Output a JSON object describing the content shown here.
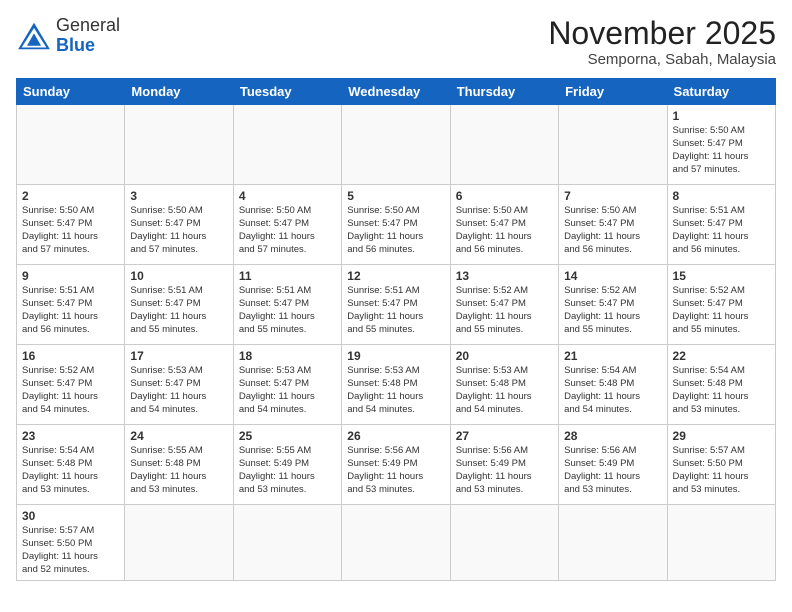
{
  "header": {
    "logo_general": "General",
    "logo_blue": "Blue",
    "month_title": "November 2025",
    "location": "Semporna, Sabah, Malaysia"
  },
  "weekdays": [
    "Sunday",
    "Monday",
    "Tuesday",
    "Wednesday",
    "Thursday",
    "Friday",
    "Saturday"
  ],
  "weeks": [
    [
      {
        "day": "",
        "info": ""
      },
      {
        "day": "",
        "info": ""
      },
      {
        "day": "",
        "info": ""
      },
      {
        "day": "",
        "info": ""
      },
      {
        "day": "",
        "info": ""
      },
      {
        "day": "",
        "info": ""
      },
      {
        "day": "1",
        "info": "Sunrise: 5:50 AM\nSunset: 5:47 PM\nDaylight: 11 hours\nand 57 minutes."
      }
    ],
    [
      {
        "day": "2",
        "info": "Sunrise: 5:50 AM\nSunset: 5:47 PM\nDaylight: 11 hours\nand 57 minutes."
      },
      {
        "day": "3",
        "info": "Sunrise: 5:50 AM\nSunset: 5:47 PM\nDaylight: 11 hours\nand 57 minutes."
      },
      {
        "day": "4",
        "info": "Sunrise: 5:50 AM\nSunset: 5:47 PM\nDaylight: 11 hours\nand 57 minutes."
      },
      {
        "day": "5",
        "info": "Sunrise: 5:50 AM\nSunset: 5:47 PM\nDaylight: 11 hours\nand 56 minutes."
      },
      {
        "day": "6",
        "info": "Sunrise: 5:50 AM\nSunset: 5:47 PM\nDaylight: 11 hours\nand 56 minutes."
      },
      {
        "day": "7",
        "info": "Sunrise: 5:50 AM\nSunset: 5:47 PM\nDaylight: 11 hours\nand 56 minutes."
      },
      {
        "day": "8",
        "info": "Sunrise: 5:51 AM\nSunset: 5:47 PM\nDaylight: 11 hours\nand 56 minutes."
      }
    ],
    [
      {
        "day": "9",
        "info": "Sunrise: 5:51 AM\nSunset: 5:47 PM\nDaylight: 11 hours\nand 56 minutes."
      },
      {
        "day": "10",
        "info": "Sunrise: 5:51 AM\nSunset: 5:47 PM\nDaylight: 11 hours\nand 55 minutes."
      },
      {
        "day": "11",
        "info": "Sunrise: 5:51 AM\nSunset: 5:47 PM\nDaylight: 11 hours\nand 55 minutes."
      },
      {
        "day": "12",
        "info": "Sunrise: 5:51 AM\nSunset: 5:47 PM\nDaylight: 11 hours\nand 55 minutes."
      },
      {
        "day": "13",
        "info": "Sunrise: 5:52 AM\nSunset: 5:47 PM\nDaylight: 11 hours\nand 55 minutes."
      },
      {
        "day": "14",
        "info": "Sunrise: 5:52 AM\nSunset: 5:47 PM\nDaylight: 11 hours\nand 55 minutes."
      },
      {
        "day": "15",
        "info": "Sunrise: 5:52 AM\nSunset: 5:47 PM\nDaylight: 11 hours\nand 55 minutes."
      }
    ],
    [
      {
        "day": "16",
        "info": "Sunrise: 5:52 AM\nSunset: 5:47 PM\nDaylight: 11 hours\nand 54 minutes."
      },
      {
        "day": "17",
        "info": "Sunrise: 5:53 AM\nSunset: 5:47 PM\nDaylight: 11 hours\nand 54 minutes."
      },
      {
        "day": "18",
        "info": "Sunrise: 5:53 AM\nSunset: 5:47 PM\nDaylight: 11 hours\nand 54 minutes."
      },
      {
        "day": "19",
        "info": "Sunrise: 5:53 AM\nSunset: 5:48 PM\nDaylight: 11 hours\nand 54 minutes."
      },
      {
        "day": "20",
        "info": "Sunrise: 5:53 AM\nSunset: 5:48 PM\nDaylight: 11 hours\nand 54 minutes."
      },
      {
        "day": "21",
        "info": "Sunrise: 5:54 AM\nSunset: 5:48 PM\nDaylight: 11 hours\nand 54 minutes."
      },
      {
        "day": "22",
        "info": "Sunrise: 5:54 AM\nSunset: 5:48 PM\nDaylight: 11 hours\nand 53 minutes."
      }
    ],
    [
      {
        "day": "23",
        "info": "Sunrise: 5:54 AM\nSunset: 5:48 PM\nDaylight: 11 hours\nand 53 minutes."
      },
      {
        "day": "24",
        "info": "Sunrise: 5:55 AM\nSunset: 5:48 PM\nDaylight: 11 hours\nand 53 minutes."
      },
      {
        "day": "25",
        "info": "Sunrise: 5:55 AM\nSunset: 5:49 PM\nDaylight: 11 hours\nand 53 minutes."
      },
      {
        "day": "26",
        "info": "Sunrise: 5:56 AM\nSunset: 5:49 PM\nDaylight: 11 hours\nand 53 minutes."
      },
      {
        "day": "27",
        "info": "Sunrise: 5:56 AM\nSunset: 5:49 PM\nDaylight: 11 hours\nand 53 minutes."
      },
      {
        "day": "28",
        "info": "Sunrise: 5:56 AM\nSunset: 5:49 PM\nDaylight: 11 hours\nand 53 minutes."
      },
      {
        "day": "29",
        "info": "Sunrise: 5:57 AM\nSunset: 5:50 PM\nDaylight: 11 hours\nand 53 minutes."
      }
    ],
    [
      {
        "day": "30",
        "info": "Sunrise: 5:57 AM\nSunset: 5:50 PM\nDaylight: 11 hours\nand 52 minutes."
      },
      {
        "day": "",
        "info": ""
      },
      {
        "day": "",
        "info": ""
      },
      {
        "day": "",
        "info": ""
      },
      {
        "day": "",
        "info": ""
      },
      {
        "day": "",
        "info": ""
      },
      {
        "day": "",
        "info": ""
      }
    ]
  ]
}
